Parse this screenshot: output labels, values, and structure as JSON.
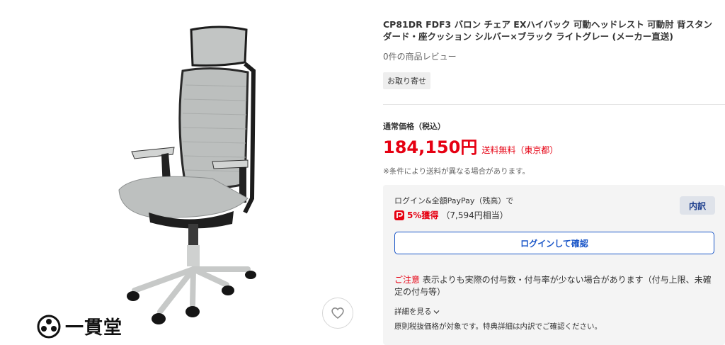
{
  "product": {
    "title": "CP81DR FDF3 バロン チェア EXハイバック 可動ヘッドレスト 可動肘 背スタンダード・座クッション シルバー×ブラック ライトグレー (メーカー直送)",
    "review_count": "0件の商品レビュー",
    "badge": "お取り寄せ"
  },
  "shop": {
    "logo_text": "一貫堂"
  },
  "price": {
    "label": "通常価格（税込）",
    "value": "184,150円",
    "shipping": "送料無料（東京都）",
    "note": "※条件により送料が異なる場合があります。"
  },
  "points": {
    "login_text": "ログイン&全額PayPay（残高）で",
    "earn": "5%獲得",
    "equivalent": "（7,594円相当）",
    "breakdown_label": "内訳",
    "login_button": "ログインして確認",
    "caution_label": "ご注意",
    "caution_text": " 表示よりも実際の付与数・付与率が少ない場合があります（付与上限、未確定の付与等）",
    "details_link": "詳細を見る",
    "footnote": "原則税抜価格が対象です。特典詳細は内訳でご確認ください。"
  },
  "icons": {
    "favorite": "heart-icon",
    "paypay": "paypay-icon",
    "details": "chevron-down-icon"
  },
  "colors": {
    "price_red": "#e60012",
    "link_blue": "#1a56c8",
    "chair_mesh": "#b9bcbb",
    "chair_frame": "#1c1c1c"
  }
}
